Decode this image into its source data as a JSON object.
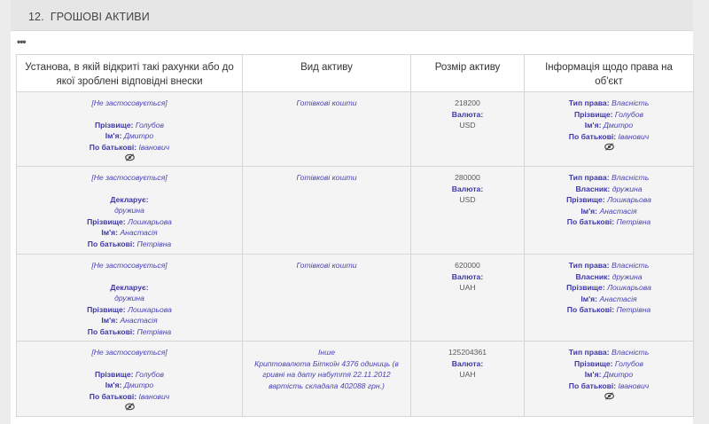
{
  "section": {
    "number": "12.",
    "title": "ГРОШОВІ АКТИВИ"
  },
  "more_label": "•••",
  "columns": [
    "Установа, в якій відкриті такі рахунки або до якої зроблені відповідні внески",
    "Вид активу",
    "Розмір активу",
    "Інформація щодо права на об'єкт"
  ],
  "labels": {
    "not_applicable": "[Не застосовується]",
    "surname": "Прізвище:",
    "name": "Ім'я:",
    "patronymic": "По батькові:",
    "declarant": "Декларує:",
    "currency": "Валюта:",
    "right_type": "Тип права:",
    "owner": "Власник:"
  },
  "rows": [
    {
      "institution": {
        "declarant": null,
        "surname": "Голубов",
        "name": "Дмитро",
        "patronymic": "Іванович",
        "eye_icon": true
      },
      "asset_type": "Готівкові кошти",
      "asset_note": "",
      "amount": "218200",
      "currency": "USD",
      "right": {
        "type": "Власність",
        "owner": null,
        "surname": "Голубов",
        "name": "Дмитро",
        "patronymic": "Іванович",
        "eye_icon": true
      }
    },
    {
      "institution": {
        "declarant": "дружина",
        "surname": "Лошкарьова",
        "name": "Анастасія",
        "patronymic": "Петрівна",
        "eye_icon": false
      },
      "asset_type": "Готівкові кошти",
      "asset_note": "",
      "amount": "280000",
      "currency": "USD",
      "right": {
        "type": "Власність",
        "owner": "дружина",
        "surname": "Лошкарьова",
        "name": "Анастасія",
        "patronymic": "Петрівна",
        "eye_icon": false
      }
    },
    {
      "institution": {
        "declarant": "дружина",
        "surname": "Лошкарьова",
        "name": "Анастасія",
        "patronymic": "Петрівна",
        "eye_icon": false
      },
      "asset_type": "Готівкові кошти",
      "asset_note": "",
      "amount": "620000",
      "currency": "UAH",
      "right": {
        "type": "Власність",
        "owner": "дружина",
        "surname": "Лошкарьова",
        "name": "Анастасія",
        "patronymic": "Петрівна",
        "eye_icon": false
      }
    },
    {
      "institution": {
        "declarant": null,
        "surname": "Голубов",
        "name": "Дмитро",
        "patronymic": "Іванович",
        "eye_icon": true
      },
      "asset_type": "Інше",
      "asset_note": "Криптовалюта Біткоїн 4376 одиниць (в гривні на дату набуття 22.11.2012 вартість складала 402088 грн.)",
      "amount": "125204361",
      "currency": "UAH",
      "right": {
        "type": "Власність",
        "owner": null,
        "surname": "Голубов",
        "name": "Дмитро",
        "patronymic": "Іванович",
        "eye_icon": true
      }
    }
  ]
}
